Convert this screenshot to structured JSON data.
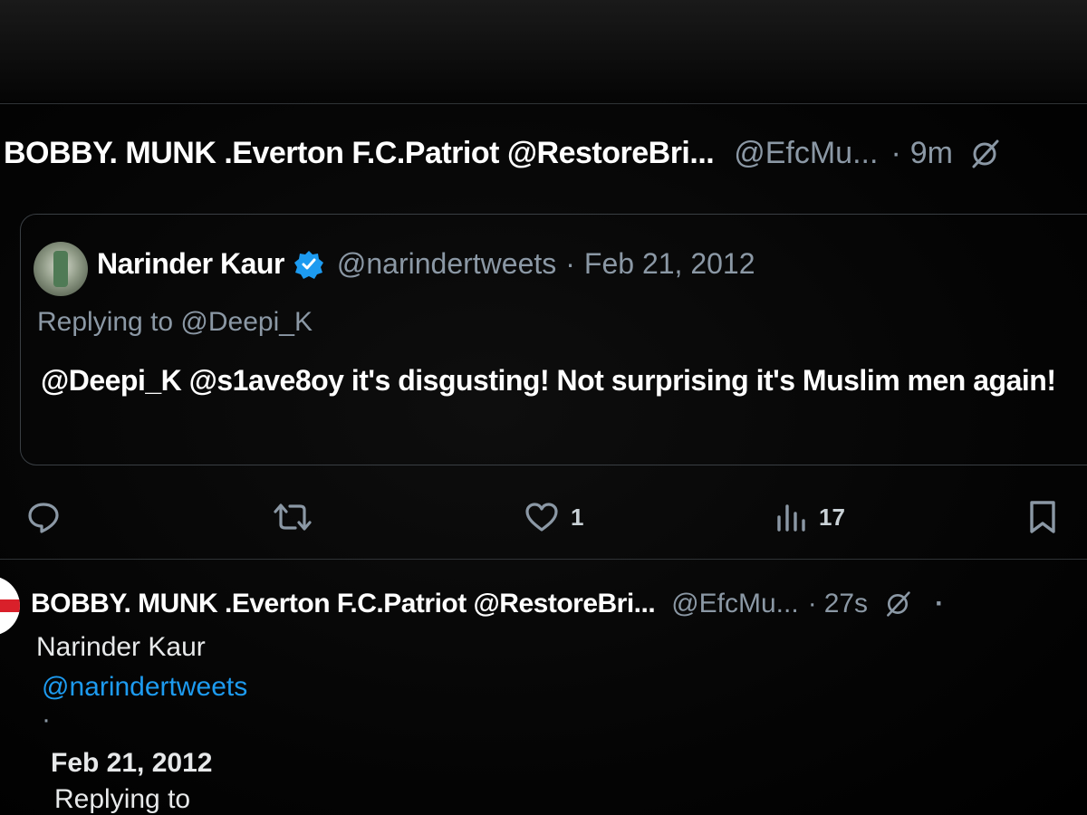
{
  "tweet1": {
    "display_name": "BOBBY. MUNK .Everton F.C.Patriot @RestoreBri...",
    "handle": "@EfcMu...",
    "separator": "·",
    "time": "9m",
    "grok_icon": "grok-slash-icon"
  },
  "quoted": {
    "display_name": "Narinder Kaur",
    "verified_icon": "verified-badge-icon",
    "handle": "@narindertweets",
    "separator": "·",
    "date": "Feb 21, 2012",
    "replying_to": "Replying to @Deepi_K",
    "body": "@Deepi_K @s1ave8oy it's disgusting! Not surprising it's Muslim men again!"
  },
  "actions": {
    "reply_icon": "reply-icon",
    "retweet_icon": "retweet-icon",
    "like_icon": "heart-icon",
    "like_count": "1",
    "views_icon": "views-bar-chart-icon",
    "view_count": "17",
    "bookmark_icon": "bookmark-icon"
  },
  "tweet2": {
    "display_name": "BOBBY. MUNK .Everton F.C.Patriot @RestoreBri...",
    "handle": "@EfcMu...",
    "separator": "·",
    "time": "27s",
    "more": "·",
    "body_name": "Narinder Kaur",
    "body_handle": "@narindertweets",
    "body_sep": "·",
    "body_date": "Feb 21, 2012",
    "body_replying": "Replying to"
  },
  "colors": {
    "background": "#000000",
    "text": "#e7e9ea",
    "muted": "#8b98a5",
    "link": "#1d9bf0",
    "verified": "#1d9bf0",
    "divider": "#2f3336"
  }
}
